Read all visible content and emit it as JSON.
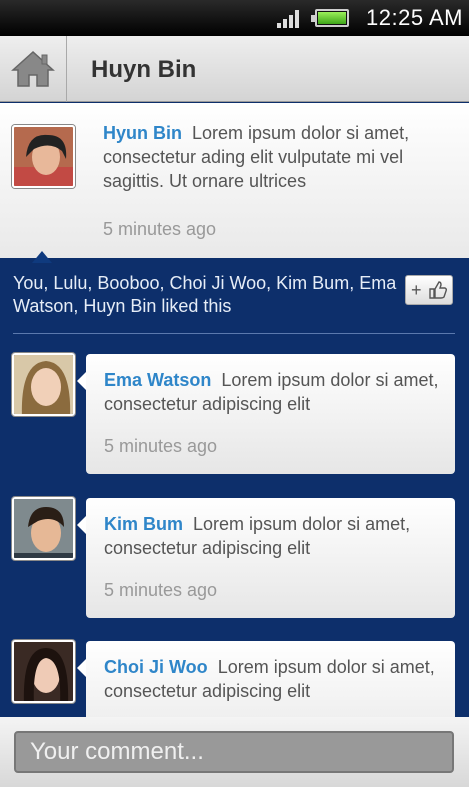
{
  "status_bar": {
    "time": "12:25 AM",
    "signal_icon": "signal-icon",
    "battery_icon": "battery-icon"
  },
  "header": {
    "title": "Huyn Bin",
    "home_icon": "home-icon"
  },
  "post": {
    "author": "Hyun Bin",
    "text": "Lorem ipsum dolor si amet, consectetur ading elit vulputate mi vel sagittis. Ut ornare ultrices",
    "time": "5 minutes ago"
  },
  "likes": {
    "text": "You, Lulu, Booboo, Choi Ji Woo, Kim Bum, Ema Watson, Huyn Bin liked this",
    "like_button_plus": "+"
  },
  "comments": [
    {
      "author": "Ema Watson",
      "text": "Lorem ipsum dolor si amet, consectetur adipiscing elit",
      "time": "5 minutes ago"
    },
    {
      "author": "Kim Bum",
      "text": "Lorem ipsum dolor si amet, consectetur adipiscing elit",
      "time": "5 minutes ago"
    },
    {
      "author": "Choi Ji Woo",
      "text": "Lorem ipsum dolor si amet, consectetur adipiscing elit",
      "time": ""
    }
  ],
  "comment_input": {
    "placeholder": "Your comment..."
  },
  "colors": {
    "accent": "#2f86c9",
    "background": "#0d2f6b"
  }
}
